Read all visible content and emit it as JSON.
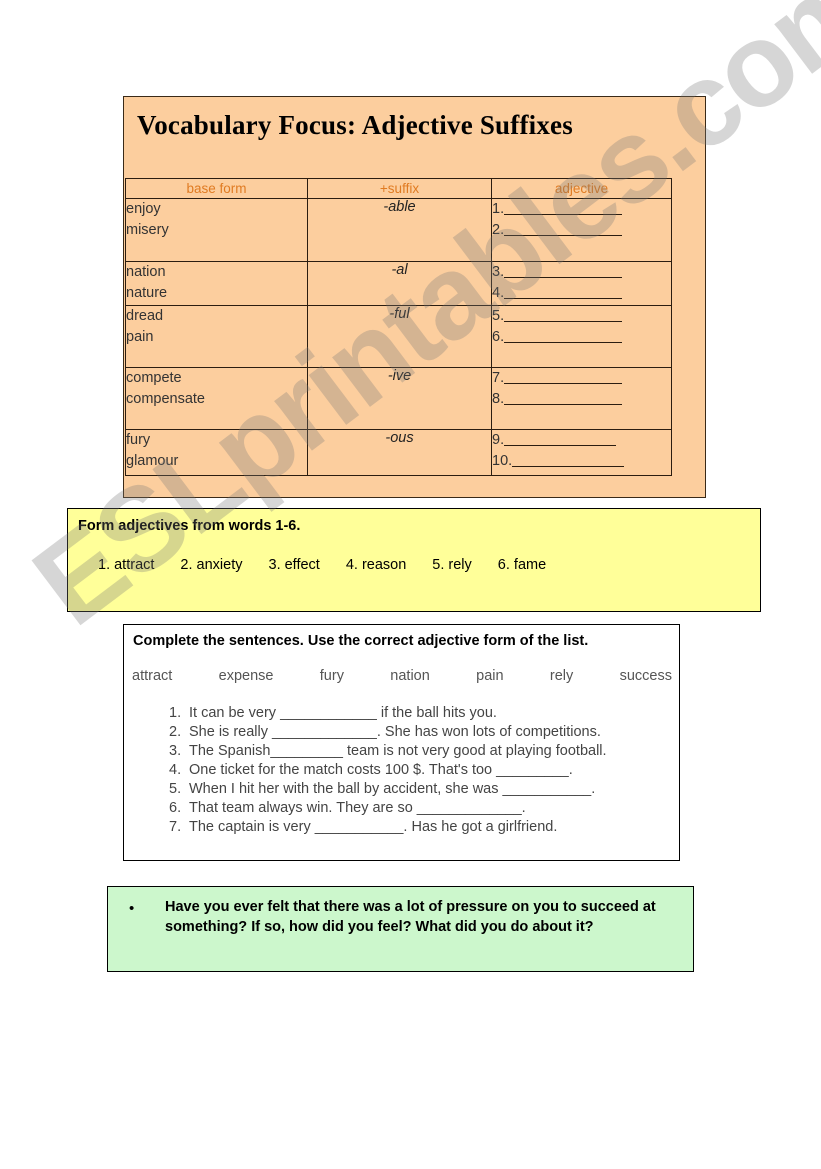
{
  "watermark": {
    "text": "ESLprintables.com"
  },
  "vocab_section": {
    "title": "Vocabulary Focus: Adjective Suffixes",
    "headers": {
      "base": "base form",
      "suffix": "+suffix",
      "adjective": "adjective"
    },
    "rows": [
      {
        "base": [
          "enjoy",
          "misery"
        ],
        "suffix": "-able",
        "answers": [
          {
            "num": "1."
          },
          {
            "num": "2."
          }
        ]
      },
      {
        "base": [
          "nation",
          "nature"
        ],
        "suffix": "-al",
        "answers": [
          {
            "num": "3."
          },
          {
            "num": "4."
          }
        ]
      },
      {
        "base": [
          "dread",
          "pain"
        ],
        "suffix": "-ful",
        "answers": [
          {
            "num": "5."
          },
          {
            "num": "6."
          }
        ]
      },
      {
        "base": [
          "compete",
          "compensate"
        ],
        "suffix": "-ive",
        "answers": [
          {
            "num": "7."
          },
          {
            "num": "8."
          }
        ]
      },
      {
        "base": [
          "fury",
          "glamour"
        ],
        "suffix": "-ous",
        "answers": [
          {
            "num": "9."
          },
          {
            "num": "10."
          }
        ]
      }
    ]
  },
  "form_adjectives_section": {
    "heading": "Form adjectives from words 1-6.",
    "words": [
      "1.  attract",
      "2. anxiety",
      "3. effect",
      "4. reason",
      "5. rely",
      "6.  fame"
    ]
  },
  "complete_sentences_section": {
    "heading": "Complete the sentences. Use the correct adjective form of the list.",
    "word_bank": [
      "attract",
      "expense",
      "fury",
      "nation",
      "pain",
      "rely",
      "success"
    ],
    "sentences": [
      {
        "num": "1.",
        "text": "It can be very ____________ if the ball hits you."
      },
      {
        "num": "2.",
        "text": "She is really _____________. She has won lots of competitions."
      },
      {
        "num": "3.",
        "text": "The Spanish_________ team is not very good at playing football."
      },
      {
        "num": "4.",
        "text": "One ticket for the match costs 100 $. That's too _________."
      },
      {
        "num": "5.",
        "text": "When I hit her with the ball by accident, she was ___________."
      },
      {
        "num": "6.",
        "text": "That team always win. They are so _____________."
      },
      {
        "num": "7.",
        "text": "The captain is very ___________. Has he got a girlfriend."
      }
    ]
  },
  "discussion_section": {
    "bullet": "•",
    "text": "Have you ever felt that there was a lot of pressure on you to succeed at something? If so, how did you feel? What did you do about it?"
  }
}
